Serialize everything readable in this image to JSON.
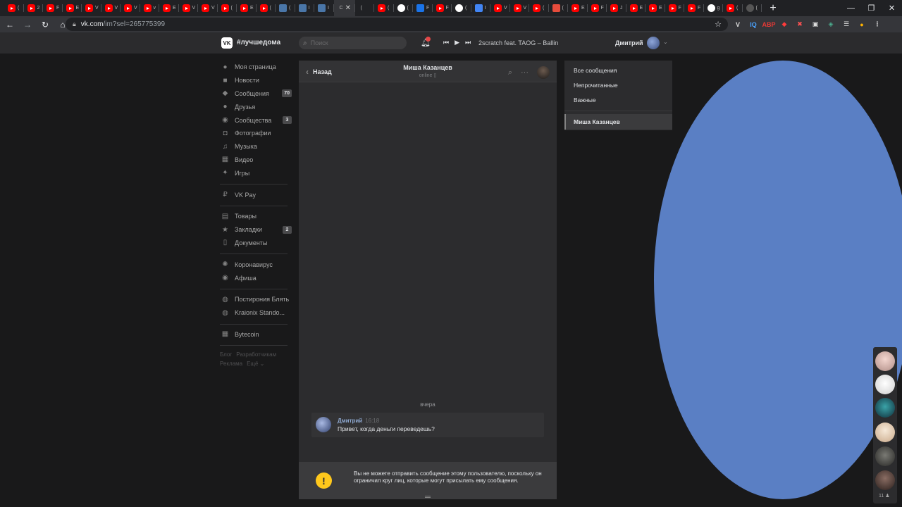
{
  "browser": {
    "tabs": [
      {
        "icon": "yt",
        "letter": "("
      },
      {
        "icon": "yt",
        "letter": "2"
      },
      {
        "icon": "yt",
        "letter": "F"
      },
      {
        "icon": "yt",
        "letter": "E"
      },
      {
        "icon": "yt",
        "letter": "V"
      },
      {
        "icon": "yt",
        "letter": "V"
      },
      {
        "icon": "yt",
        "letter": "V"
      },
      {
        "icon": "yt",
        "letter": "v"
      },
      {
        "icon": "yt",
        "letter": "E"
      },
      {
        "icon": "yt",
        "letter": "V"
      },
      {
        "icon": "yt",
        "letter": "V"
      },
      {
        "icon": "yt",
        "letter": "("
      },
      {
        "icon": "yt",
        "letter": "E"
      },
      {
        "icon": "yt",
        "letter": "("
      },
      {
        "icon": "vk",
        "letter": "("
      },
      {
        "icon": "vk",
        "letter": "I"
      },
      {
        "icon": "vk",
        "letter": "I"
      },
      {
        "icon": "active",
        "letter": "C"
      },
      {
        "icon": "chat",
        "letter": "("
      },
      {
        "icon": "yt",
        "letter": "("
      },
      {
        "icon": "gg",
        "letter": "("
      },
      {
        "icon": "chart",
        "letter": "F"
      },
      {
        "icon": "yt",
        "letter": "F"
      },
      {
        "icon": "gg",
        "letter": "("
      },
      {
        "icon": "doc",
        "letter": "I"
      },
      {
        "icon": "yt",
        "letter": "V"
      },
      {
        "icon": "yt",
        "letter": "V"
      },
      {
        "icon": "yt",
        "letter": "("
      },
      {
        "icon": "mail",
        "letter": "("
      },
      {
        "icon": "yt",
        "letter": "E"
      },
      {
        "icon": "yt",
        "letter": "F"
      },
      {
        "icon": "yt",
        "letter": "J"
      },
      {
        "icon": "yt",
        "letter": "E"
      },
      {
        "icon": "yt",
        "letter": "E"
      },
      {
        "icon": "yt",
        "letter": "F"
      },
      {
        "icon": "yt",
        "letter": "F"
      },
      {
        "icon": "gg",
        "letter": "g"
      },
      {
        "icon": "yt",
        "letter": "("
      },
      {
        "icon": "tw",
        "letter": "("
      }
    ],
    "url_host": "vk.com",
    "url_path": "/im?sel=265775399"
  },
  "vk": {
    "logo_text": "VK",
    "community_tag": "#лучшедома",
    "search_placeholder": "Поиск",
    "now_playing": "2scratch feat. TAOG – Ballin",
    "user_name": "Дмитрий"
  },
  "sidebar": {
    "groups": [
      [
        {
          "icon": "user-icon",
          "glyph": "●",
          "label": "Моя страница",
          "count": ""
        },
        {
          "icon": "news-icon",
          "glyph": "■",
          "label": "Новости",
          "count": ""
        },
        {
          "icon": "messages-icon",
          "glyph": "◆",
          "label": "Сообщения",
          "count": "70"
        },
        {
          "icon": "friends-icon",
          "glyph": "●",
          "label": "Друзья",
          "count": ""
        },
        {
          "icon": "communities-icon",
          "glyph": "◉",
          "label": "Сообщества",
          "count": "3"
        },
        {
          "icon": "photos-icon",
          "glyph": "◘",
          "label": "Фотографии",
          "count": ""
        },
        {
          "icon": "music-icon",
          "glyph": "♫",
          "label": "Музыка",
          "count": ""
        },
        {
          "icon": "video-icon",
          "glyph": "▦",
          "label": "Видео",
          "count": ""
        },
        {
          "icon": "games-icon",
          "glyph": "✦",
          "label": "Игры",
          "count": ""
        }
      ],
      [
        {
          "icon": "vkpay-icon",
          "glyph": "₽",
          "label": "VK Pay",
          "count": ""
        }
      ],
      [
        {
          "icon": "market-icon",
          "glyph": "▤",
          "label": "Товары",
          "count": ""
        },
        {
          "icon": "bookmarks-icon",
          "glyph": "★",
          "label": "Закладки",
          "count": "2"
        },
        {
          "icon": "documents-icon",
          "glyph": "▯",
          "label": "Документы",
          "count": ""
        }
      ],
      [
        {
          "icon": "coronavirus-icon",
          "glyph": "✺",
          "label": "Коронавирус",
          "count": ""
        },
        {
          "icon": "afisha-icon",
          "glyph": "◉",
          "label": "Афиша",
          "count": ""
        }
      ],
      [
        {
          "icon": "group-icon",
          "glyph": "◍",
          "label": "Постирония Блять",
          "count": ""
        },
        {
          "icon": "group-icon",
          "glyph": "◍",
          "label": "Kraionix Stando...",
          "count": ""
        }
      ],
      [
        {
          "icon": "apps-icon",
          "glyph": "▦",
          "label": "Bytecoin",
          "count": ""
        }
      ]
    ],
    "footer": [
      "Блог",
      "Разработчикам",
      "Реклама",
      "Ещё ⌄"
    ]
  },
  "chat": {
    "back_label": "Назад",
    "peer_name": "Миша Казанцев",
    "peer_status": "online ▯",
    "day_separator": "вчера",
    "message": {
      "author": "Дмитрий",
      "time": "16:18",
      "text": "Привет, когда деньги переведешь?"
    },
    "warning_text": "Вы не можете отправить сообщение этому пользователю, поскольку он ограничил круг лиц, которые могут присылать ему сообщения."
  },
  "filters": {
    "items": [
      "Все сообщения",
      "Непрочитанные",
      "Важные"
    ],
    "selected_conversation": "Миша Казанцев"
  },
  "friends_strip": {
    "online_count": "11 ♟"
  },
  "colors": {
    "bg": "#19191a",
    "panel": "#2c2c2e",
    "header": "#2b2b2d",
    "accent_badge": "#e64646",
    "warning": "#ffc81c",
    "author": "#8ea8cf"
  }
}
